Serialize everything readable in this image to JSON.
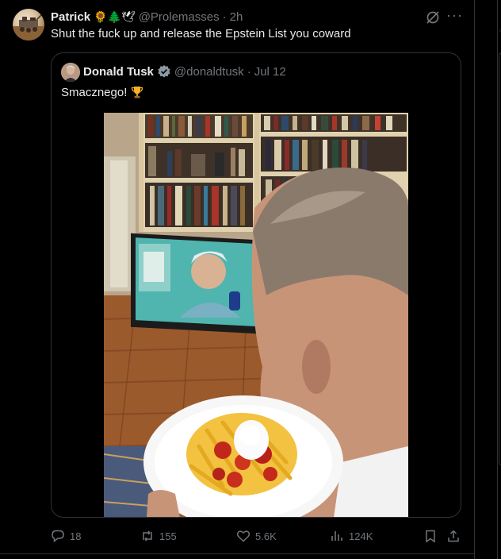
{
  "tweet": {
    "author_name": "Patrick",
    "author_emojis": "🌻🌲🕊",
    "handle": "@Prolemasses",
    "separator": "·",
    "time": "2h",
    "text": "Shut the fuck up and release the Epstein List you coward"
  },
  "quoted": {
    "author_name": "Donald Tusk",
    "handle": "@donaldtusk",
    "separator": "·",
    "date": "Jul 12",
    "text": "Smacznego!",
    "text_emoji": "trophy-icon"
  },
  "actions": {
    "replies": "18",
    "reposts": "155",
    "likes": "5.6K",
    "views": "124K"
  },
  "colors": {
    "background": "#000000",
    "text_primary": "#e7e9ea",
    "text_secondary": "#71767b",
    "border": "#2f3336",
    "verified": "#8b98a5"
  }
}
